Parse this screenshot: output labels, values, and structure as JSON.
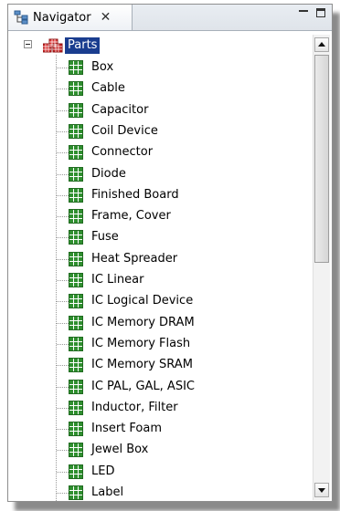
{
  "view": {
    "tab_title": "Navigator",
    "tab_close": "✕",
    "tab_icon": "navigator-tree-icon",
    "minimize_icon": "minimize-icon",
    "maximize_icon": "maximize-icon"
  },
  "tree": {
    "root": {
      "label": "Parts",
      "icon": "parts-folder-icon",
      "expanded": true,
      "selected": true
    },
    "items": [
      {
        "label": "Box",
        "icon": "table-grid-icon"
      },
      {
        "label": "Cable",
        "icon": "table-grid-icon"
      },
      {
        "label": "Capacitor",
        "icon": "table-grid-icon"
      },
      {
        "label": "Coil Device",
        "icon": "table-grid-icon"
      },
      {
        "label": "Connector",
        "icon": "table-grid-icon"
      },
      {
        "label": "Diode",
        "icon": "table-grid-icon"
      },
      {
        "label": "Finished Board",
        "icon": "table-grid-icon"
      },
      {
        "label": "Frame, Cover",
        "icon": "table-grid-icon"
      },
      {
        "label": "Fuse",
        "icon": "table-grid-icon"
      },
      {
        "label": "Heat Spreader",
        "icon": "table-grid-icon"
      },
      {
        "label": "IC Linear",
        "icon": "table-grid-icon"
      },
      {
        "label": "IC Logical Device",
        "icon": "table-grid-icon"
      },
      {
        "label": "IC Memory DRAM",
        "icon": "table-grid-icon"
      },
      {
        "label": "IC Memory Flash",
        "icon": "table-grid-icon"
      },
      {
        "label": "IC Memory SRAM",
        "icon": "table-grid-icon"
      },
      {
        "label": "IC PAL, GAL, ASIC",
        "icon": "table-grid-icon"
      },
      {
        "label": "Inductor, Filter",
        "icon": "table-grid-icon"
      },
      {
        "label": "Insert Foam",
        "icon": "table-grid-icon"
      },
      {
        "label": "Jewel Box",
        "icon": "table-grid-icon"
      },
      {
        "label": "LED",
        "icon": "table-grid-icon"
      },
      {
        "label": "Label",
        "icon": "table-grid-icon"
      }
    ]
  },
  "colors": {
    "selection": "#1a3d8f",
    "grid_icon": "#2f8f2f",
    "root_icon": "#d42a2a"
  }
}
